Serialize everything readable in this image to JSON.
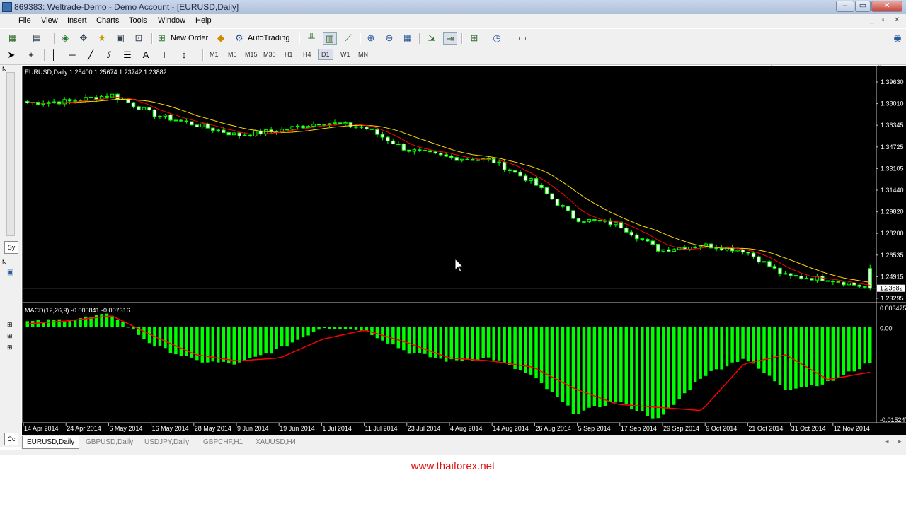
{
  "window": {
    "title": "869383: Weltrade-Demo - Demo Account - [EURUSD,Daily]",
    "minimize_label": "–",
    "restore_label": "▭",
    "close_label": "✕"
  },
  "menu": [
    "File",
    "View",
    "Insert",
    "Charts",
    "Tools",
    "Window",
    "Help"
  ],
  "toolbar": {
    "new_order_label": "New Order",
    "autotrading_label": "AutoTrading",
    "timeframes": [
      "M1",
      "M5",
      "M15",
      "M30",
      "H1",
      "H4",
      "D1",
      "W1",
      "MN"
    ],
    "active_timeframe": "D1",
    "search_placeholder": ""
  },
  "left_panel": {
    "tab_top": "Sy",
    "tab_bottom": "Cc",
    "label_n1": "N",
    "label_n2": "N"
  },
  "chart": {
    "header": "EURUSD,Daily  1.25400 1.25674 1.23742 1.23882",
    "price_labels": [
      "1.39630",
      "1.38010",
      "1.36345",
      "1.34725",
      "1.33105",
      "1.31440",
      "1.29820",
      "1.28200",
      "1.26535",
      "1.24915",
      "1.23295"
    ],
    "current_price": "1.23882",
    "macd_header": "MACD(12,26,9) -0.005841 -0.007316",
    "macd_labels": [
      "0.003475",
      "0.00",
      "-0.015247"
    ],
    "date_labels": [
      "14 Apr 2014",
      "24 Apr 2014",
      "6 May 2014",
      "16 May 2014",
      "28 May 2014",
      "9 Jun 2014",
      "19 Jun 2014",
      "1 Jul 2014",
      "11 Jul 2014",
      "23 Jul 2014",
      "4 Aug 2014",
      "14 Aug 2014",
      "26 Aug 2014",
      "5 Sep 2014",
      "17 Sep 2014",
      "29 Sep 2014",
      "9 Oct 2014",
      "21 Oct 2014",
      "31 Oct 2014",
      "12 Nov 2014"
    ],
    "colors": {
      "background": "#000000",
      "candle": "#00ff00",
      "fast_ma": "#ff0000",
      "slow_ma": "#ffd800",
      "macd_hist": "#00ff00",
      "macd_signal": "#ff0000",
      "axis_text": "#ffffff"
    }
  },
  "chart_data": {
    "type": "candlestick",
    "symbol": "EURUSD",
    "timeframe": "Daily",
    "ylim": [
      1.23,
      1.399
    ],
    "x": [
      "14 Apr 2014",
      "24 Apr 2014",
      "6 May 2014",
      "16 May 2014",
      "28 May 2014",
      "9 Jun 2014",
      "19 Jun 2014",
      "1 Jul 2014",
      "11 Jul 2014",
      "23 Jul 2014",
      "4 Aug 2014",
      "14 Aug 2014",
      "26 Aug 2014",
      "5 Sep 2014",
      "17 Sep 2014",
      "29 Sep 2014",
      "9 Oct 2014",
      "21 Oct 2014",
      "31 Oct 2014",
      "12 Nov 2014",
      "Nov 2014 last"
    ],
    "close_approx": [
      1.381,
      1.382,
      1.387,
      1.372,
      1.364,
      1.356,
      1.36,
      1.366,
      1.362,
      1.345,
      1.339,
      1.337,
      1.32,
      1.292,
      1.288,
      1.268,
      1.272,
      1.268,
      1.248,
      1.246,
      1.2388
    ],
    "last_bar": {
      "open": 1.254,
      "high": 1.25674,
      "low": 1.23742,
      "close": 1.23882
    },
    "indicator": {
      "name": "MACD(12,26,9)",
      "main": -0.005841,
      "signal": -0.007316,
      "ylim": [
        -0.015247,
        0.003475
      ],
      "hist_approx": [
        0.0008,
        0.0012,
        0.002,
        -0.003,
        -0.0055,
        -0.006,
        -0.0035,
        0.0,
        -0.0005,
        -0.004,
        -0.0055,
        -0.005,
        -0.008,
        -0.014,
        -0.012,
        -0.015,
        -0.008,
        -0.005,
        -0.01,
        -0.009,
        -0.0058
      ],
      "signal_approx": [
        0.0005,
        0.001,
        0.0018,
        -0.0015,
        -0.0045,
        -0.0055,
        -0.005,
        -0.002,
        -0.0005,
        -0.0025,
        -0.005,
        -0.0055,
        -0.0065,
        -0.01,
        -0.0125,
        -0.013,
        -0.0135,
        -0.006,
        -0.0045,
        -0.0085,
        -0.0073
      ]
    }
  },
  "chart_tabs": [
    "EURUSD,Daily",
    "GBPUSD,Daily",
    "USDJPY,Daily",
    "GBPCHF,H1",
    "XAUUSD,H4"
  ],
  "active_tab": "EURUSD,Daily",
  "footer": {
    "watermark": "www.thaiforex.net"
  }
}
